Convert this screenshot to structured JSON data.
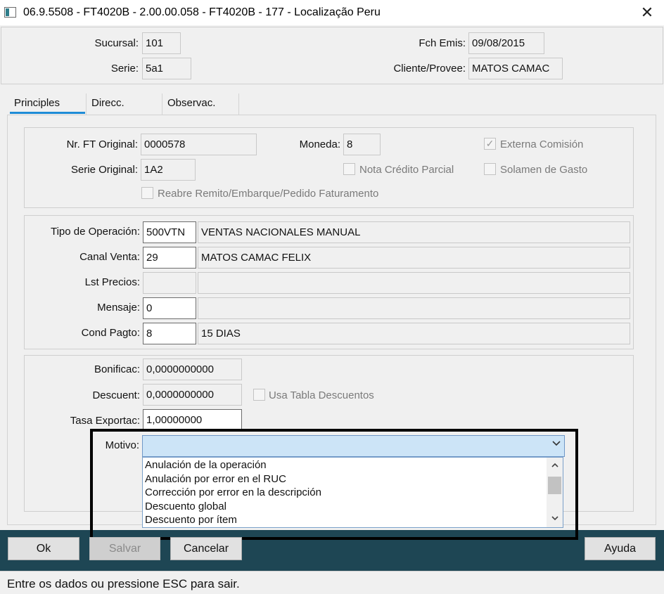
{
  "window": {
    "title": "06.9.5508 - FT4020B - 2.00.00.058 - FT4020B - 177 - Localização Peru",
    "close_glyph": "✕"
  },
  "header": {
    "sucursal_label": "Sucursal:",
    "sucursal_value": "101",
    "serie_label": "Serie:",
    "serie_value": "5a1",
    "fch_emis_label": "Fch Emis:",
    "fch_emis_value": "09/08/2015",
    "cliente_label": "Cliente/Provee:",
    "cliente_value": "MATOS CAMAC"
  },
  "tabs": [
    {
      "label": "Principles",
      "active": true
    },
    {
      "label": "Direcc.",
      "active": false
    },
    {
      "label": "Observac.",
      "active": false
    }
  ],
  "section1": {
    "nr_ft_original_label": "Nr. FT Original:",
    "nr_ft_original_value": "0000578",
    "moneda_label": "Moneda:",
    "moneda_value": "8",
    "serie_original_label": "Serie Original:",
    "serie_original_value": "1A2",
    "externa_comision_label": "Externa Comisión",
    "nota_credito_label": "Nota Crédito Parcial",
    "solamen_gasto_label": "Solamen de Gasto",
    "reabre_label": "Reabre Remito/Embarque/Pedido Faturamento"
  },
  "section2": {
    "tipo_operacion_label": "Tipo de Operación:",
    "tipo_operacion_code": "500VTN",
    "tipo_operacion_desc": "VENTAS NACIONALES MANUAL",
    "canal_venta_label": "Canal Venta:",
    "canal_venta_code": "29",
    "canal_venta_desc": "MATOS CAMAC FELIX",
    "lst_precios_label": "Lst Precios:",
    "mensaje_label": "Mensaje:",
    "mensaje_code": "0",
    "cond_pagto_label": "Cond Pagto:",
    "cond_pagto_code": "8",
    "cond_pagto_desc": "15 DIAS"
  },
  "section3": {
    "bonificac_label": "Bonificac:",
    "bonificac_value": "0,0000000000",
    "descuent_label": "Descuent:",
    "descuent_value": "0,0000000000",
    "usa_tabla_label": "Usa Tabla Descuentos",
    "tasa_exportac_label": "Tasa Exportac:",
    "tasa_exportac_value": "1,00000000",
    "motivo_label": "Motivo:",
    "motivo_value": "",
    "motivo_options": [
      "Anulación de la operación",
      "Anulación por error en el RUC",
      "Corrección por error en la descripción",
      "Descuento global",
      "Descuento por ítem"
    ]
  },
  "buttons": {
    "ok": "Ok",
    "salvar": "Salvar",
    "cancelar": "Cancelar",
    "ayuda": "Ayuda"
  },
  "status": {
    "text": "Entre os dados ou pressione ESC para sair."
  },
  "colors": {
    "bottom_bar": "#1e4654",
    "tab_accent": "#1f8cd6",
    "combo_focus": "#cce4f7"
  }
}
